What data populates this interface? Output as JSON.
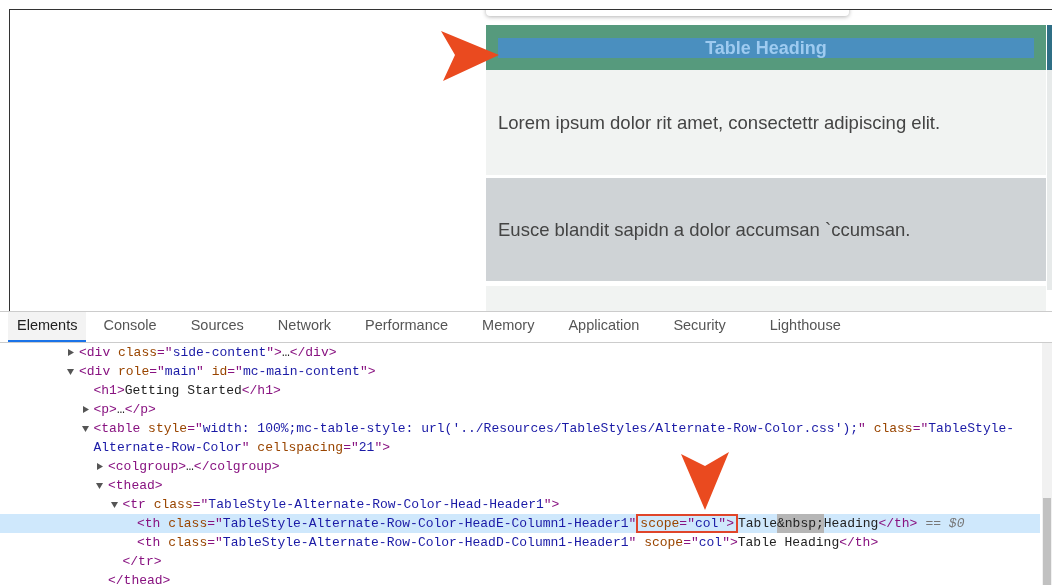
{
  "page": {
    "table": {
      "heading": "Table Heading",
      "rows": [
        "Lorem ipsum dolor rit amet, consectettr adipiscing elit.",
        "Eusce blandit sapidn a dolor accumsan `ccumsan."
      ]
    }
  },
  "devtools": {
    "tabs": [
      {
        "label": "Elements",
        "selected": true
      },
      {
        "label": "Console",
        "selected": false
      },
      {
        "label": "Sources",
        "selected": false
      },
      {
        "label": "Network",
        "selected": false
      },
      {
        "label": "Performance",
        "selected": false
      },
      {
        "label": "Memory",
        "selected": false
      },
      {
        "label": "Application",
        "selected": false
      },
      {
        "label": "Security",
        "selected": false
      },
      {
        "label": "Lighthouse",
        "selected": false
      }
    ],
    "dom": [
      {
        "expanded": false,
        "selected": false,
        "tokens": [
          {
            "kind": "tag",
            "text": "<div "
          },
          {
            "kind": "attr",
            "text": "class"
          },
          {
            "kind": "tag",
            "text": "=\""
          },
          {
            "kind": "value",
            "text": "side-content"
          },
          {
            "kind": "tag",
            "text": "\">"
          },
          {
            "kind": "text",
            "text": "…"
          },
          {
            "kind": "tag",
            "text": "</div>"
          }
        ]
      },
      {
        "expanded": true,
        "selected": false,
        "tokens": [
          {
            "kind": "tag",
            "text": "<div "
          },
          {
            "kind": "attr",
            "text": "role"
          },
          {
            "kind": "tag",
            "text": "=\""
          },
          {
            "kind": "value",
            "text": "main"
          },
          {
            "kind": "tag",
            "text": "\" "
          },
          {
            "kind": "attr",
            "text": "id"
          },
          {
            "kind": "tag",
            "text": "=\""
          },
          {
            "kind": "value",
            "text": "mc-main-content"
          },
          {
            "kind": "tag",
            "text": "\">"
          }
        ],
        "children": [
          {
            "selected": false,
            "tokens": [
              {
                "kind": "tag",
                "text": "<h1>"
              },
              {
                "kind": "text",
                "text": "Getting Started"
              },
              {
                "kind": "tag",
                "text": "</h1>"
              }
            ]
          },
          {
            "expanded": false,
            "selected": false,
            "tokens": [
              {
                "kind": "tag",
                "text": "<p>"
              },
              {
                "kind": "text",
                "text": "…"
              },
              {
                "kind": "tag",
                "text": "</p>"
              }
            ]
          },
          {
            "expanded": true,
            "selected": false,
            "tokens": [
              {
                "kind": "tag",
                "text": "<table "
              },
              {
                "kind": "attr",
                "text": "style"
              },
              {
                "kind": "tag",
                "text": "=\""
              },
              {
                "kind": "value",
                "text": "width: 100%;mc-table-style: url('../Resources/TableStyles/Alternate-Row-Color.css');"
              },
              {
                "kind": "tag",
                "text": "\" "
              },
              {
                "kind": "attr",
                "text": "class"
              },
              {
                "kind": "tag",
                "text": "=\""
              },
              {
                "kind": "value",
                "text": "TableStyle-"
              },
              {
                "kind": "value",
                "text": "Alternate-Row-Color"
              },
              {
                "kind": "tag",
                "text": "\" "
              },
              {
                "kind": "attr",
                "text": "cellspacing"
              },
              {
                "kind": "tag",
                "text": "=\""
              },
              {
                "kind": "value",
                "text": "21"
              },
              {
                "kind": "tag",
                "text": "\">"
              }
            ],
            "children": [
              {
                "expanded": false,
                "selected": false,
                "tokens": [
                  {
                    "kind": "tag",
                    "text": "<colgroup>"
                  },
                  {
                    "kind": "text",
                    "text": "…"
                  },
                  {
                    "kind": "tag",
                    "text": "</colgroup>"
                  }
                ]
              },
              {
                "expanded": true,
                "selected": false,
                "tokens": [
                  {
                    "kind": "tag",
                    "text": "<thead>"
                  }
                ],
                "close": "</thead>",
                "children": [
                  {
                    "expanded": true,
                    "selected": false,
                    "tokens": [
                      {
                        "kind": "tag",
                        "text": "<tr "
                      },
                      {
                        "kind": "attr",
                        "text": "class"
                      },
                      {
                        "kind": "tag",
                        "text": "=\""
                      },
                      {
                        "kind": "value",
                        "text": "TableStyle-Alternate-Row-Color-Head-Header1"
                      },
                      {
                        "kind": "tag",
                        "text": "\">"
                      }
                    ],
                    "close": "</tr>",
                    "children": [
                      {
                        "selected": true,
                        "suffix": "== $0",
                        "tokens": [
                          {
                            "kind": "tag",
                            "text": "<th "
                          },
                          {
                            "kind": "attr",
                            "text": "class"
                          },
                          {
                            "kind": "tag",
                            "text": "=\""
                          },
                          {
                            "kind": "value",
                            "text": "TableStyle-Alternate-Row-Color-HeadE-Column1-Header1"
                          },
                          {
                            "kind": "tag",
                            "text": "\""
                          },
                          {
                            "kind": "callout",
                            "parts": [
                              {
                                "kind": "attr",
                                "text": "scope"
                              },
                              {
                                "kind": "tag",
                                "text": "=\""
                              },
                              {
                                "kind": "value",
                                "text": "col"
                              },
                              {
                                "kind": "tag",
                                "text": "\">"
                              }
                            ]
                          },
                          {
                            "kind": "text",
                            "text": "Table"
                          },
                          {
                            "kind": "entity",
                            "text": "&nbsp;"
                          },
                          {
                            "kind": "text",
                            "text": "Heading"
                          },
                          {
                            "kind": "tag",
                            "text": "</th>"
                          }
                        ]
                      },
                      {
                        "selected": false,
                        "tokens": [
                          {
                            "kind": "tag",
                            "text": "<th "
                          },
                          {
                            "kind": "attr",
                            "text": "class"
                          },
                          {
                            "kind": "tag",
                            "text": "=\""
                          },
                          {
                            "kind": "value",
                            "text": "TableStyle-Alternate-Row-Color-HeadD-Column1-Header1"
                          },
                          {
                            "kind": "tag",
                            "text": "\" "
                          },
                          {
                            "kind": "attr",
                            "text": "scope"
                          },
                          {
                            "kind": "tag",
                            "text": "=\""
                          },
                          {
                            "kind": "value",
                            "text": "col"
                          },
                          {
                            "kind": "tag",
                            "text": "\">"
                          },
                          {
                            "kind": "text",
                            "text": "Table Heading"
                          },
                          {
                            "kind": "tag",
                            "text": "</th>"
                          }
                        ]
                      }
                    ]
                  }
                ]
              }
            ]
          }
        ]
      }
    ]
  }
}
